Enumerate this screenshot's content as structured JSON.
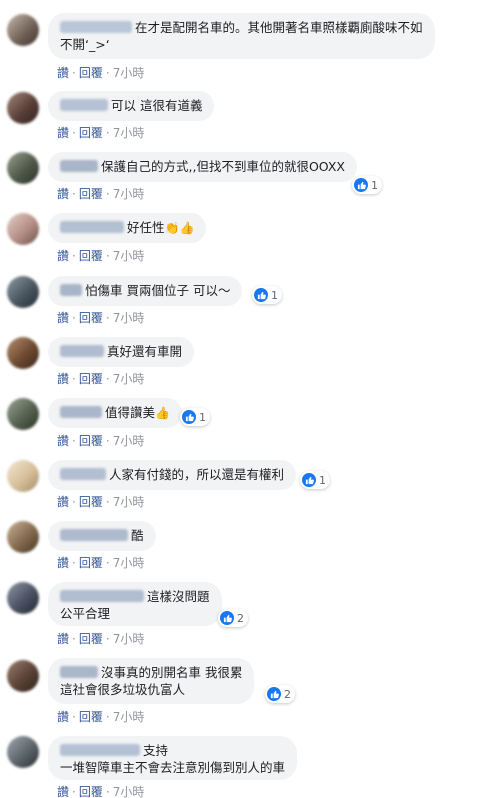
{
  "labels": {
    "like": "讚",
    "reply": "回覆",
    "dot": "·"
  },
  "comments": [
    {
      "text": "在才是配開名車的。其他開著名車照樣覇廁酸味不如",
      "text2": "不開‘_>‘",
      "time": "7小時",
      "reaction_count": ""
    },
    {
      "text": "可以 這很有道義",
      "time": "7小時",
      "reaction_count": ""
    },
    {
      "text": "保護自己的方式,,但找不到車位的就很OOXX",
      "time": "7小時",
      "reaction_count": "1"
    },
    {
      "text": "好任性",
      "emoji": "👏👍",
      "time": "7小時",
      "reaction_count": ""
    },
    {
      "text": "怕傷車 買兩個位子 可以～",
      "time": "7小時",
      "reaction_count": "1"
    },
    {
      "text": "真好還有車開",
      "time": "7小時",
      "reaction_count": ""
    },
    {
      "text": "值得讚美",
      "emoji": "👍",
      "time": "7小時",
      "reaction_count": "1"
    },
    {
      "text": "人家有付錢的，所以還是有權利",
      "time": "7小時",
      "reaction_count": "1"
    },
    {
      "text": "酷",
      "time": "7小時",
      "reaction_count": ""
    },
    {
      "text": "這樣沒問題",
      "text2": "公平合理",
      "time": "7小時",
      "reaction_count": "2"
    },
    {
      "text": "沒事真的別開名車 我很累",
      "text2": "這社會很多垃圾仇富人",
      "time": "7小時",
      "reaction_count": "2"
    },
    {
      "text": "支持",
      "text2": "一堆智障車主不會去注意別傷到別人的車",
      "time": "7小時",
      "reaction_count": ""
    }
  ],
  "colors": {
    "like_blue": "#1877f2",
    "link": "#385898",
    "bubble": "#f2f3f5"
  }
}
